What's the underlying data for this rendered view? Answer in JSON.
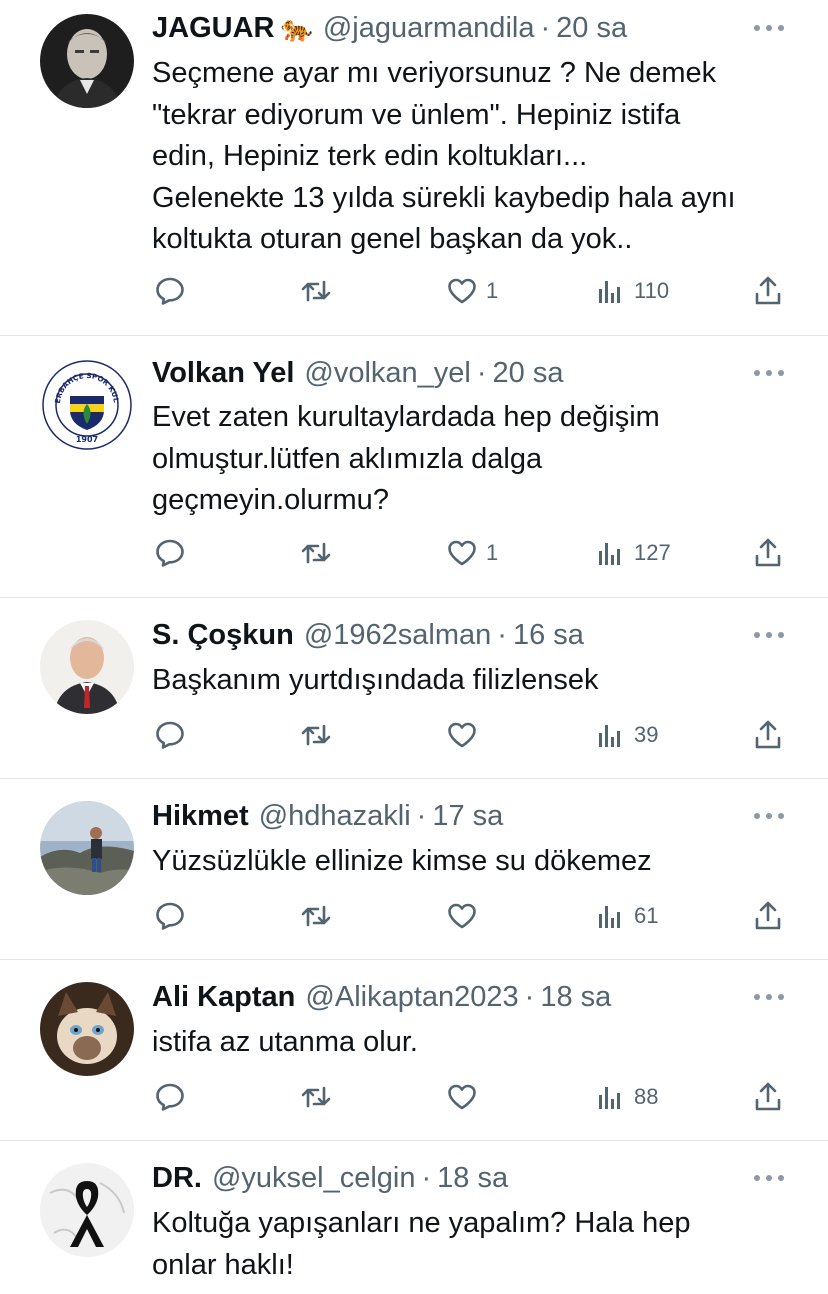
{
  "tweets": [
    {
      "name": "JAGUAR",
      "emoji": "🐅",
      "handle": "@jaguarmandila",
      "time": "20 sa",
      "lines": [
        "Seçmene ayar mı veriyorsunuz ? Ne demek",
        "\"tekrar ediyorum ve ünlem\". Hepiniz istifa",
        "edin, Hepiniz terk edin koltukları...",
        "Gelenekte 13 yılda sürekli kaybedip hala aynı",
        "koltukta oturan genel başkan da yok.."
      ],
      "likes": "1",
      "views": "110"
    },
    {
      "name": "Volkan Yel",
      "emoji": "",
      "handle": "@volkan_yel",
      "time": "20 sa",
      "lines": [
        "Evet zaten kurultaylardada hep değişim",
        "olmuştur.lütfen aklımızla dalga",
        "geçmeyin.olurmu?"
      ],
      "likes": "1",
      "views": "127",
      "avatar_text": {
        "top": "FENERBAHÇE SPOR KULÜBÜ",
        "year": "1907"
      }
    },
    {
      "name": "S. Çoşkun",
      "emoji": "",
      "handle": "@1962salman",
      "time": "16 sa",
      "lines": [
        "Başkanım yurtdışındada filizlensek"
      ],
      "likes": "",
      "views": "39"
    },
    {
      "name": "Hikmet",
      "emoji": "",
      "handle": "@hdhazakli",
      "time": "17 sa",
      "lines": [
        "Yüzsüzlükle ellinize kimse su dökemez"
      ],
      "likes": "",
      "views": "61"
    },
    {
      "name": "Ali Kaptan",
      "emoji": "",
      "handle": "@Alikaptan2023",
      "time": "18 sa",
      "lines": [
        "istifa az utanma olur."
      ],
      "likes": "",
      "views": "88"
    },
    {
      "name": "DR.",
      "emoji": "",
      "handle": "@yuksel_celgin",
      "time": "18 sa",
      "lines": [
        "Koltuğa yapışanları ne yapalım? Hala hep",
        "onlar haklı!"
      ],
      "likes": "",
      "views": ""
    }
  ],
  "colors": {
    "text": "#0f1419",
    "secondary": "#536471",
    "divider": "#e1e6ea",
    "fb_yellow": "#f6d41b",
    "fb_navy": "#1b2a6b"
  },
  "icons": [
    "reply-icon",
    "retweet-icon",
    "like-icon",
    "views-icon",
    "share-icon",
    "more-icon"
  ]
}
